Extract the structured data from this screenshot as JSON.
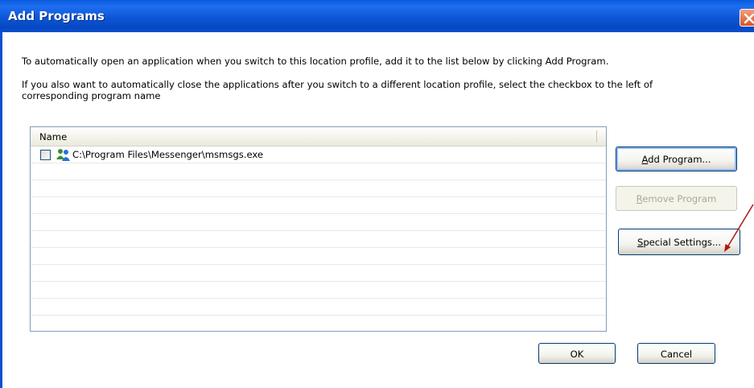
{
  "window": {
    "title": "Add Programs",
    "close_icon": "close-icon"
  },
  "instructions": {
    "line1": "To automatically open an application when you switch to this location profile, add it to the list below by clicking Add Program.",
    "line2a": "If you also want to automatically close the applications after you switch to a different location profile, select the checkbox to the left of",
    "line2b": "corresponding program name"
  },
  "program_list": {
    "column_header": "Name",
    "items": [
      {
        "checked": false,
        "icon": "messenger-icon",
        "path": "C:\\Program Files\\Messenger\\msmsgs.exe"
      }
    ]
  },
  "buttons": {
    "add_program": {
      "mnemonic": "A",
      "rest": "dd Program..."
    },
    "remove_program": {
      "mnemonic": "R",
      "rest": "emove Program",
      "disabled": true
    },
    "special_settings": {
      "mnemonic": "S",
      "rest": "pecial Settings..."
    },
    "ok": "OK",
    "cancel": "Cancel"
  },
  "colors": {
    "titlebar": "#0a57d6",
    "annotation_arrow": "#b01515"
  }
}
